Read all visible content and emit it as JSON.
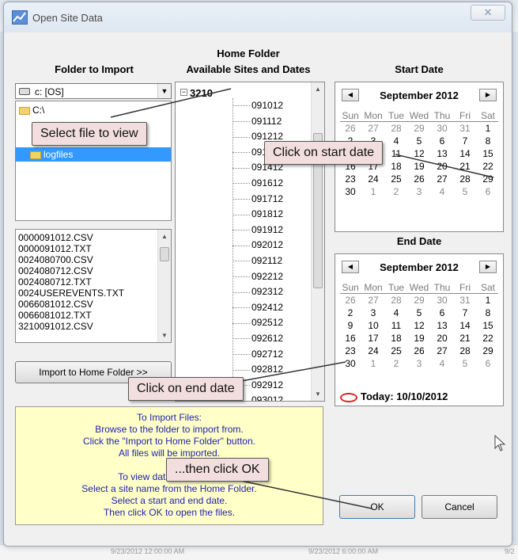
{
  "background": {
    "axis_labels": [
      "9/23/2012 12:00:00 AM",
      "9/23/2012 6:00:00 AM",
      "9/2"
    ]
  },
  "window": {
    "title": "Open Site Data",
    "close_symbol": "✕"
  },
  "folder_to_import": {
    "heading": "Folder to Import",
    "drive": "c: [OS]",
    "folders": [
      "C:\\",
      "logfiles"
    ],
    "files": [
      "0000091012.CSV",
      "0000091012.TXT",
      "0024080700.CSV",
      "0024080712.CSV",
      "0024080712.TXT",
      "0024USEREVENTS.TXT",
      "0066081012.CSV",
      "0066081012.TXT",
      "3210091012.CSV"
    ],
    "import_button": "Import to Home Folder >>"
  },
  "home_folder": {
    "heading_line1": "Home Folder",
    "heading_line2": "Available Sites and Dates",
    "root": "3210",
    "items": [
      "091012",
      "091112",
      "091212",
      "091312",
      "091412",
      "091612",
      "091712",
      "091812",
      "091912",
      "092012",
      "092112",
      "092212",
      "092312",
      "092412",
      "092512",
      "092612",
      "092712",
      "092812",
      "092912",
      "093012"
    ]
  },
  "start_date": {
    "heading": "Start Date",
    "month_label": "September 2012",
    "dows": [
      "Sun",
      "Mon",
      "Tue",
      "Wed",
      "Thu",
      "Fri",
      "Sat"
    ],
    "weeks": [
      [
        "26",
        "27",
        "28",
        "29",
        "30",
        "31",
        "1"
      ],
      [
        "2",
        "3",
        "4",
        "5",
        "6",
        "7",
        "8"
      ],
      [
        "9",
        "10",
        "11",
        "12",
        "13",
        "14",
        "15"
      ],
      [
        "16",
        "17",
        "18",
        "19",
        "20",
        "21",
        "22"
      ],
      [
        "23",
        "24",
        "25",
        "26",
        "27",
        "28",
        "29"
      ],
      [
        "30",
        "1",
        "2",
        "3",
        "4",
        "5",
        "6"
      ]
    ]
  },
  "end_date": {
    "heading": "End Date",
    "month_label": "September 2012",
    "dows": [
      "Sun",
      "Mon",
      "Tue",
      "Wed",
      "Thu",
      "Fri",
      "Sat"
    ],
    "weeks": [
      [
        "26",
        "27",
        "28",
        "29",
        "30",
        "31",
        "1"
      ],
      [
        "2",
        "3",
        "4",
        "5",
        "6",
        "7",
        "8"
      ],
      [
        "9",
        "10",
        "11",
        "12",
        "13",
        "14",
        "15"
      ],
      [
        "16",
        "17",
        "18",
        "19",
        "20",
        "21",
        "22"
      ],
      [
        "23",
        "24",
        "25",
        "26",
        "27",
        "28",
        "29"
      ],
      [
        "30",
        "1",
        "2",
        "3",
        "4",
        "5",
        "6"
      ]
    ],
    "today_label": "Today: 10/10/2012"
  },
  "help_text": {
    "lines": [
      "To Import Files:",
      "Browse to the folder to import from.",
      "Click the \"Import to Home Folder\" button.",
      "All files will be imported.",
      "",
      "To view data from a site:",
      "Select a site name from the Home Folder.",
      "Select a start and end date.",
      "Then click OK to open the files."
    ]
  },
  "buttons": {
    "ok": "OK",
    "cancel": "Cancel"
  },
  "callouts": {
    "select_file": "Select file to view",
    "start_date": "Click on start date",
    "end_date": "Click on end date",
    "then_ok": "...then click OK"
  },
  "colors": {
    "selection": "#3399ff",
    "help_bg": "#ffffc8",
    "help_text": "#1f1fb0",
    "callout_bg": "#f2dede",
    "today_ring": "#e02020"
  }
}
